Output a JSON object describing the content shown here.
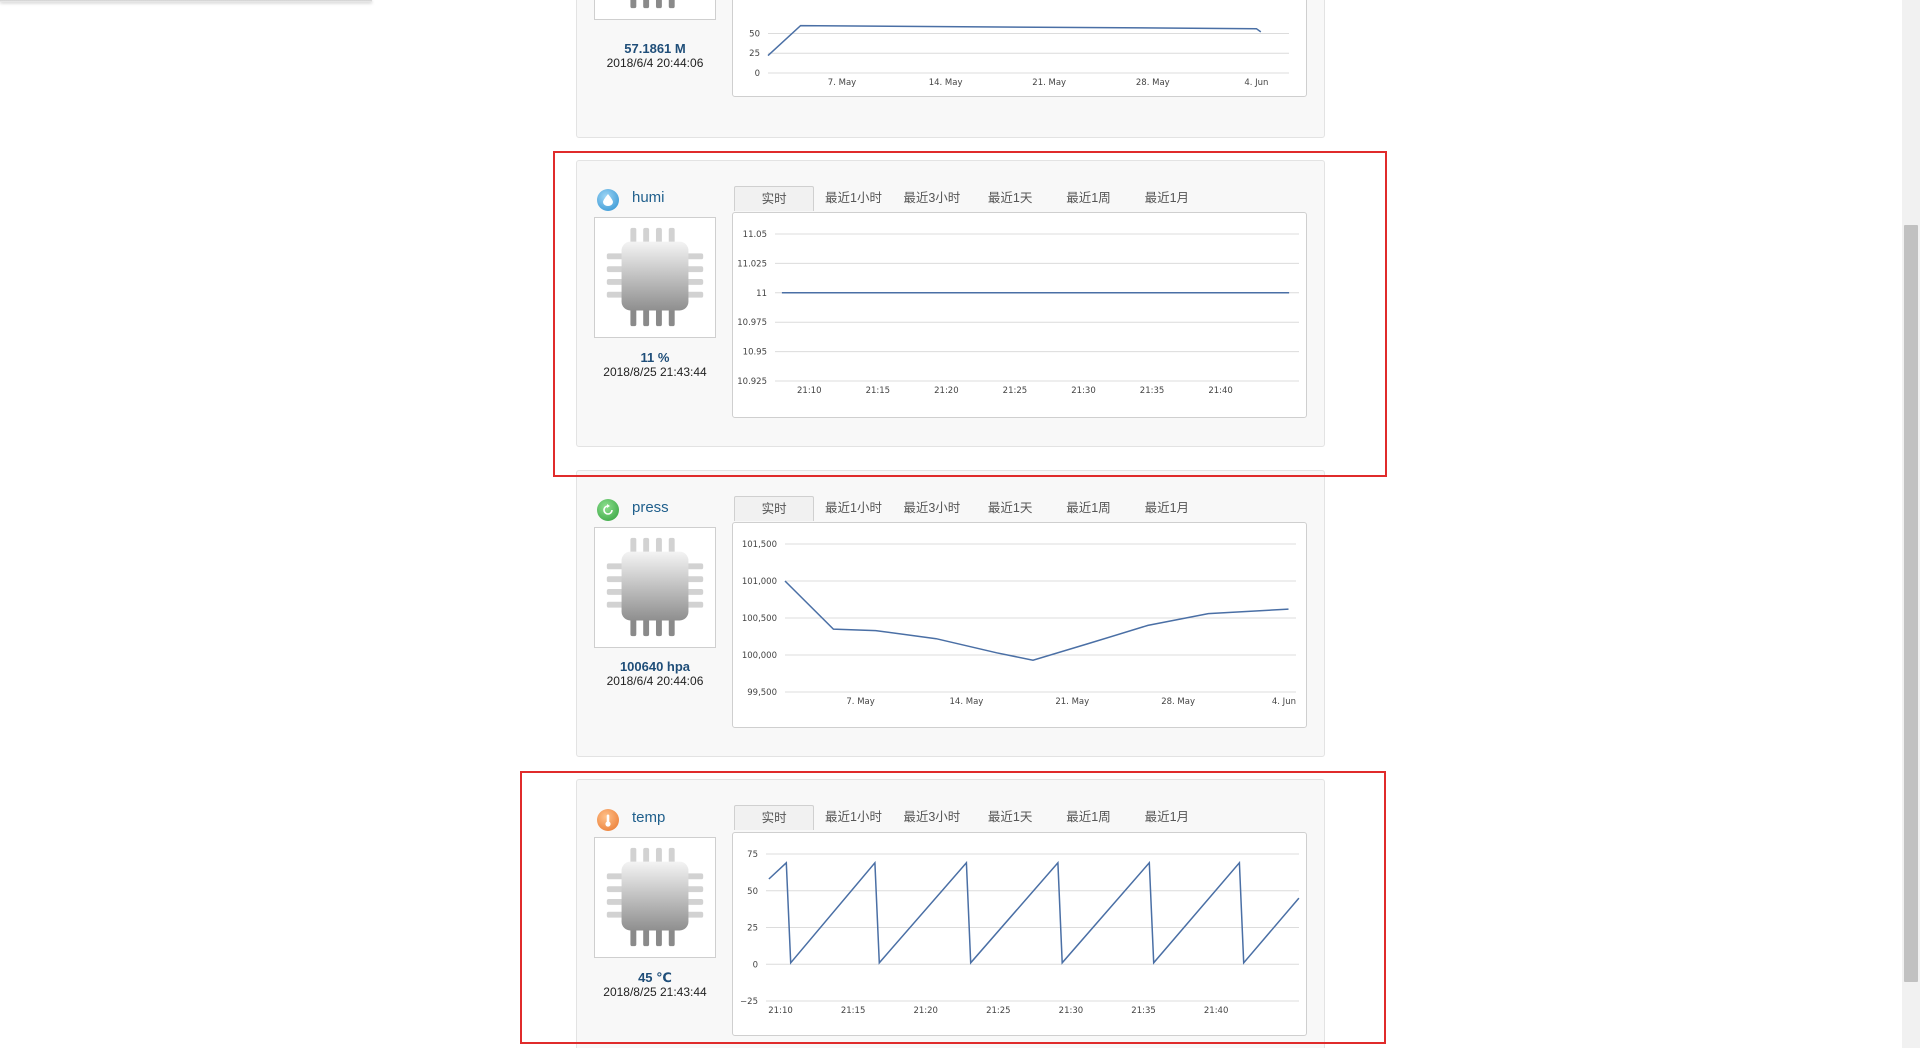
{
  "tabs": [
    "实时",
    "最近1小时",
    "最近3小时",
    "最近1天",
    "最近1周",
    "最近1月"
  ],
  "colors": {
    "line": "#4a6fa5",
    "highlight": "#e02b2b",
    "value_text": "#1f4e79"
  },
  "cards": [
    {
      "id": "partial",
      "name": "",
      "icon": "",
      "value": "57.1861 M",
      "timestamp": "2018/6/4 20:44:06"
    },
    {
      "id": "humi",
      "name": "humi",
      "icon": "water-drop-icon",
      "value": "11 %",
      "timestamp": "2018/8/25 21:43:44"
    },
    {
      "id": "press",
      "name": "press",
      "icon": "refresh-icon",
      "value": "100640 hpa",
      "timestamp": "2018/6/4 20:44:06"
    },
    {
      "id": "temp",
      "name": "temp",
      "icon": "thermometer-icon",
      "value": "45 ℃",
      "timestamp": "2018/8/25 21:43:44"
    }
  ],
  "chart_data": [
    {
      "type": "line",
      "card": "partial",
      "x_ticks": [
        "7. May",
        "14. May",
        "21. May",
        "28. May",
        "4. Jun"
      ],
      "y_ticks": [
        "0",
        "25",
        "50"
      ],
      "ylim": [
        0,
        105
      ],
      "x_range": [
        0,
        35
      ],
      "tick_x": [
        5,
        12,
        19,
        26,
        33
      ],
      "series": [
        {
          "x": [
            0,
            2.2,
            33,
            33.3
          ],
          "y": [
            22,
            60,
            56,
            52
          ]
        }
      ],
      "grid": true
    },
    {
      "type": "line",
      "card": "humi",
      "x_ticks": [
        "21:10",
        "21:15",
        "21:20",
        "21:25",
        "21:30",
        "21:35",
        "21:40"
      ],
      "y_ticks": [
        "10.925",
        "10.95",
        "10.975",
        "11",
        "11.025",
        "11.05"
      ],
      "ylim": [
        10.925,
        11.05
      ],
      "x_range": [
        21.3,
        35
      ],
      "tick_x": [
        10,
        15,
        20,
        25,
        30,
        35,
        40
      ],
      "x_domain": [
        7.5,
        45.5
      ],
      "series": [
        {
          "x": [
            8,
            45
          ],
          "y": [
            11,
            11
          ]
        }
      ],
      "grid": true
    },
    {
      "type": "line",
      "card": "press",
      "x_ticks": [
        "7. May",
        "14. May",
        "21. May",
        "28. May",
        "4. Jun"
      ],
      "y_ticks": [
        "99,500",
        "100,000",
        "100,500",
        "101,000",
        "101,500"
      ],
      "ylim": [
        99500,
        101500
      ],
      "x_domain": [
        0,
        33.6
      ],
      "tick_x": [
        5,
        12,
        19,
        26,
        33
      ],
      "series": [
        {
          "x": [
            0,
            3.2,
            6,
            10,
            14,
            16.4,
            20,
            24,
            28,
            33.3
          ],
          "y": [
            101000,
            100350,
            100330,
            100220,
            100030,
            99930,
            100150,
            100400,
            100560,
            100620
          ]
        }
      ],
      "grid": true
    },
    {
      "type": "line",
      "card": "temp",
      "x_ticks": [
        "21:10",
        "21:15",
        "21:20",
        "21:25",
        "21:30",
        "21:35",
        "21:40"
      ],
      "y_ticks": [
        "−25",
        "0",
        "25",
        "50",
        "75"
      ],
      "ylim": [
        -25,
        75
      ],
      "x_domain": [
        9,
        45.5
      ],
      "tick_x": [
        10,
        15,
        20,
        25,
        30,
        35,
        40
      ],
      "series": [
        {
          "x": [
            9.2,
            10.4,
            10.7,
            16.5,
            16.8,
            22.8,
            23.1,
            29.1,
            29.4,
            35.4,
            35.7,
            41.6,
            41.9,
            45.7
          ],
          "y": [
            58,
            69,
            1,
            69,
            1,
            69,
            1,
            69,
            1,
            69,
            1,
            69,
            1,
            45
          ]
        }
      ],
      "grid": true
    }
  ]
}
